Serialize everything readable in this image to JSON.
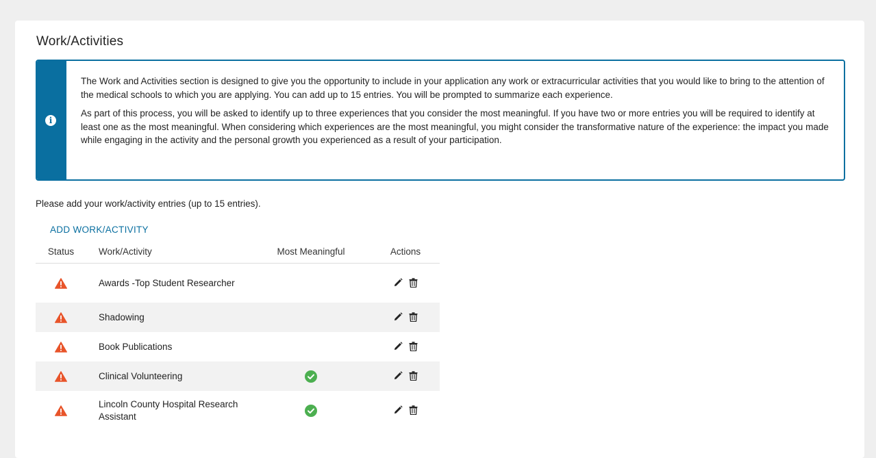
{
  "page": {
    "title": "Work/Activities"
  },
  "info": {
    "paragraph1": "The Work and Activities section is designed to give you the opportunity to include in your application any work or extracurricular activities that you would like to bring to the attention of the medical schools to which you are applying. You can add up to 15 entries. You will be prompted to summarize each experience.",
    "paragraph2": "As part of this process, you will be asked to identify up to three experiences that you consider the most meaningful. If you have two or more entries you will be required to identify at least one as the most meaningful. When considering which experiences are the most meaningful, you might consider the transformative nature of the experience: the impact you made while engaging in the activity and the personal growth you experienced as a result of your participation.",
    "icon": "info-icon"
  },
  "entries_note": "Please add your work/activity entries (up to 15 entries).",
  "add_link": "ADD WORK/ACTIVITY",
  "table": {
    "headers": {
      "status": "Status",
      "name": "Work/Activity",
      "most_meaningful": "Most Meaningful",
      "actions": "Actions"
    },
    "rows": [
      {
        "name": "Awards -Top Student Researcher",
        "status": "warning",
        "most_meaningful": false
      },
      {
        "name": "Shadowing",
        "status": "warning",
        "most_meaningful": false
      },
      {
        "name": "Book Publications",
        "status": "warning",
        "most_meaningful": false
      },
      {
        "name": "Clinical Volunteering",
        "status": "warning",
        "most_meaningful": true
      },
      {
        "name": "Lincoln County Hospital Research Assistant",
        "status": "warning",
        "most_meaningful": true
      }
    ]
  },
  "colors": {
    "accent": "#0a6fa0",
    "warning": "#e8542a",
    "success": "#4caf50",
    "row_alt": "#f2f2f2"
  },
  "icons": {
    "status": "warning-icon",
    "most_meaningful": "check-circle-icon",
    "edit": "pencil-icon",
    "delete": "trash-icon"
  }
}
